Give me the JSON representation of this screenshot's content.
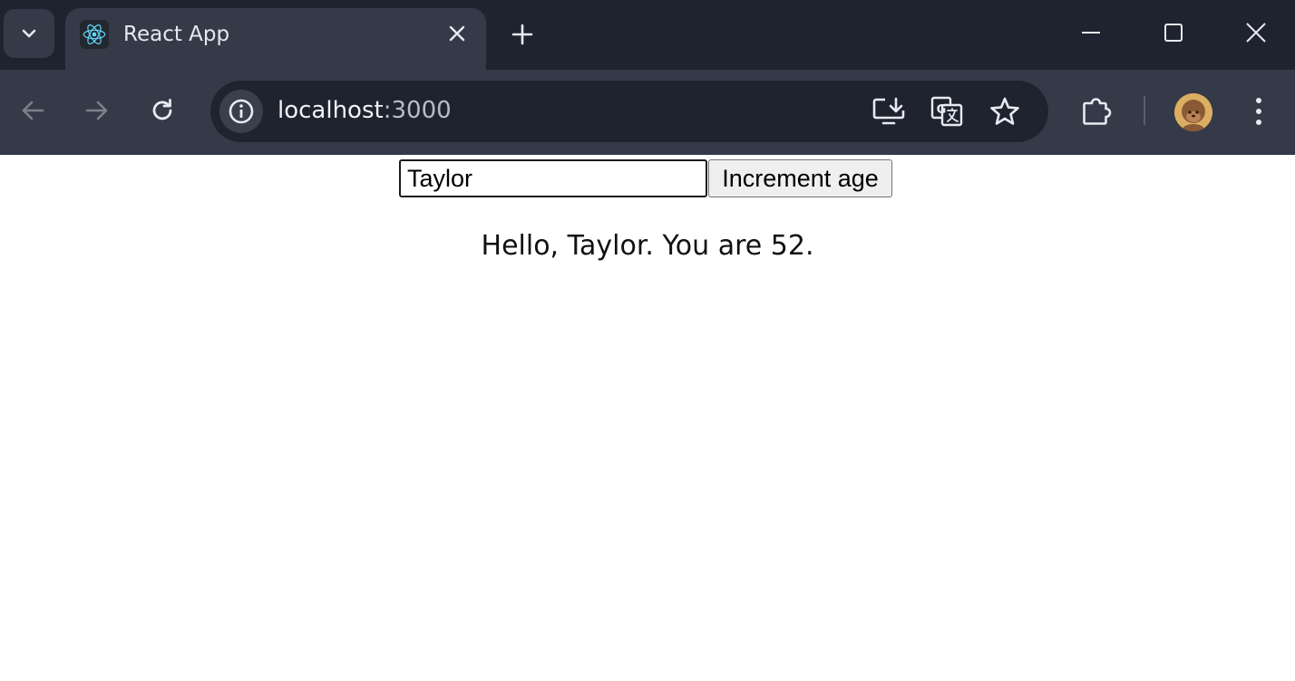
{
  "browser": {
    "tab": {
      "title": "React App"
    },
    "address_bar": {
      "host": "localhost",
      "port": ":3000"
    }
  },
  "icons": {
    "tab_search": "chevron-down-icon",
    "favicon": "react-logo-icon",
    "tab_close": "close-icon",
    "new_tab": "plus-icon",
    "minimize": "minimize-icon",
    "maximize": "maximize-icon",
    "window_close": "close-icon",
    "back": "arrow-left-icon",
    "forward": "arrow-right-icon",
    "reload": "reload-icon",
    "site_info": "info-icon",
    "install_app": "install-app-icon",
    "translate": "translate-icon",
    "bookmark": "star-icon",
    "extensions": "puzzle-icon",
    "profile": "avatar",
    "menu": "three-dots-icon"
  },
  "colors": {
    "titlebar_bg": "#1f2330",
    "toolbar_bg": "#353a49",
    "react_blue": "#61dafb"
  },
  "app": {
    "name_input_value": "Taylor",
    "increment_button_label": "Increment age",
    "greeting": "Hello, Taylor. You are 52."
  }
}
